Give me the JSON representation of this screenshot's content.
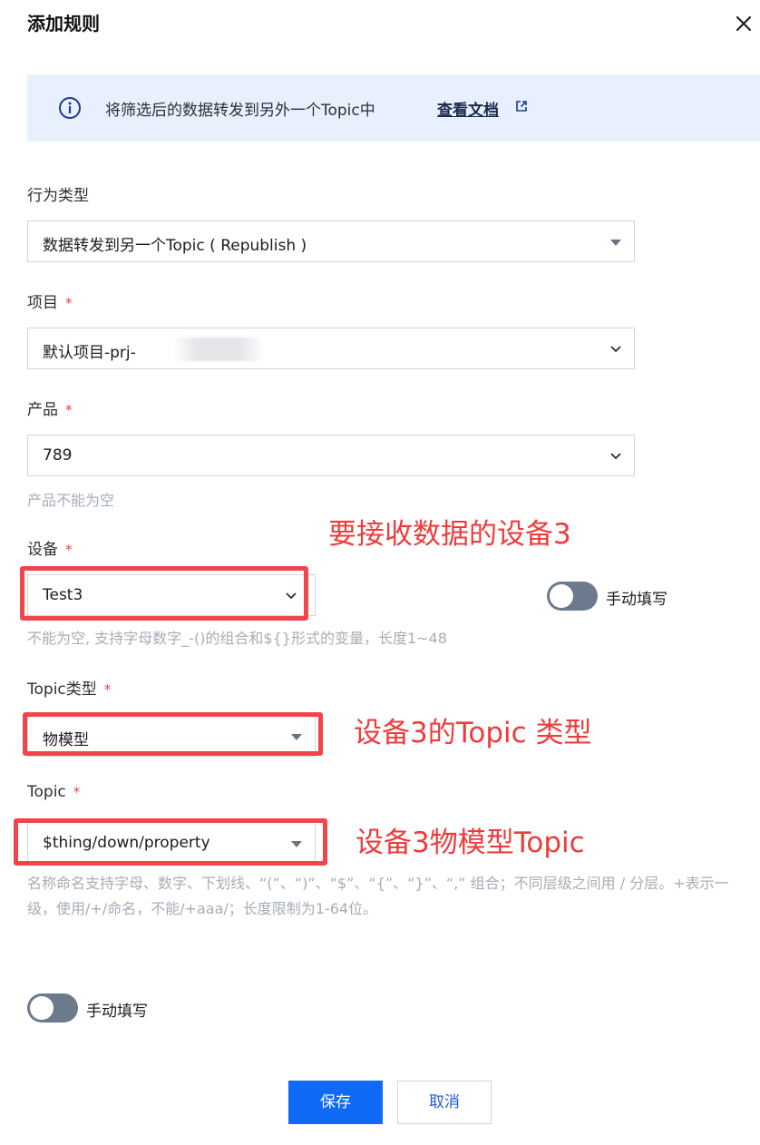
{
  "dialog": {
    "title": "添加规则",
    "close_icon": "close-icon"
  },
  "banner": {
    "text": "将筛选后的数据转发到另外一个Topic中",
    "link_label": "查看文档",
    "info_icon": "info-icon",
    "external_icon": "external-link-icon"
  },
  "form": {
    "action_type": {
      "label": "行为类型",
      "value": "数据转发到另一个Topic ( Republish )"
    },
    "project": {
      "label": "项目",
      "required_mark": "*",
      "value": "默认项目-prj-"
    },
    "product": {
      "label": "产品",
      "required_mark": "*",
      "value": "789",
      "hint": "产品不能为空"
    },
    "device": {
      "label": "设备",
      "required_mark": "*",
      "value": "Test3",
      "hint": "不能为空, 支持字母数字_-()的组合和${}形式的变量，长度1~48",
      "manual_toggle_label": "手动填写",
      "manual_toggle_on": false
    },
    "topic_type": {
      "label": "Topic类型",
      "required_mark": "*",
      "value": "物模型"
    },
    "topic": {
      "label": "Topic",
      "required_mark": "*",
      "value": "$thing/down/property",
      "hint": "名称命名支持字母、数字、下划线、“(”、“)”、“$”、“{”、“}”、“,” 组合；不同层级之间用 / 分层。+表示一级，使用/+/命名，不能/+aaa/；长度限制为1-64位。"
    },
    "manual_toggle": {
      "label": "手动填写",
      "on": false
    }
  },
  "annotations": {
    "device": "要接收数据的设备3",
    "topic_type": "设备3的Topic  类型",
    "topic": "设备3物模型Topic",
    "color": "#ef3b3b"
  },
  "footer": {
    "save_label": "保存",
    "cancel_label": "取消"
  },
  "colors": {
    "primary": "#0f6bf5",
    "banner_bg": "#e8f0fd",
    "required": "#e54545",
    "toggle_off": "#6c7a8e"
  }
}
